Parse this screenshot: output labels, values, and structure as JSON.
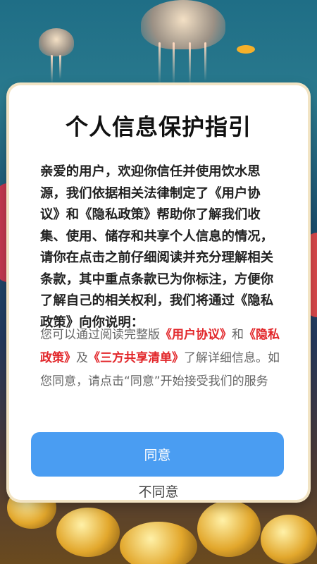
{
  "dialog": {
    "title": "个人信息保护指引",
    "intro": "亲爱的用户，欢迎你信任并使用饮水思源，我们依据相关法律制定了《用户协议》和《隐私政策》帮助你了解我们收集、使用、储存和共享个人信息的情况，请你在点击之前仔细阅读并充分理解相关条款，其中重点条款已为你标注，方便你了解自己的相关权利，我们将通过《隐私政策》向你说明：",
    "notice": {
      "prefix": "您可以通过阅读完整版",
      "link_user_agreement": "《用户协议》",
      "and": "和",
      "link_privacy_policy": "《隐私政策》",
      "and2": "及",
      "link_third_party": "《三方共享清单》",
      "suffix": "了解详细信息。如您同意，请点击“同意”开始接受我们的服务"
    },
    "agree_label": "同意",
    "disagree_label": "不同意"
  },
  "colors": {
    "accent": "#4a9df2",
    "link": "#e2262a"
  }
}
